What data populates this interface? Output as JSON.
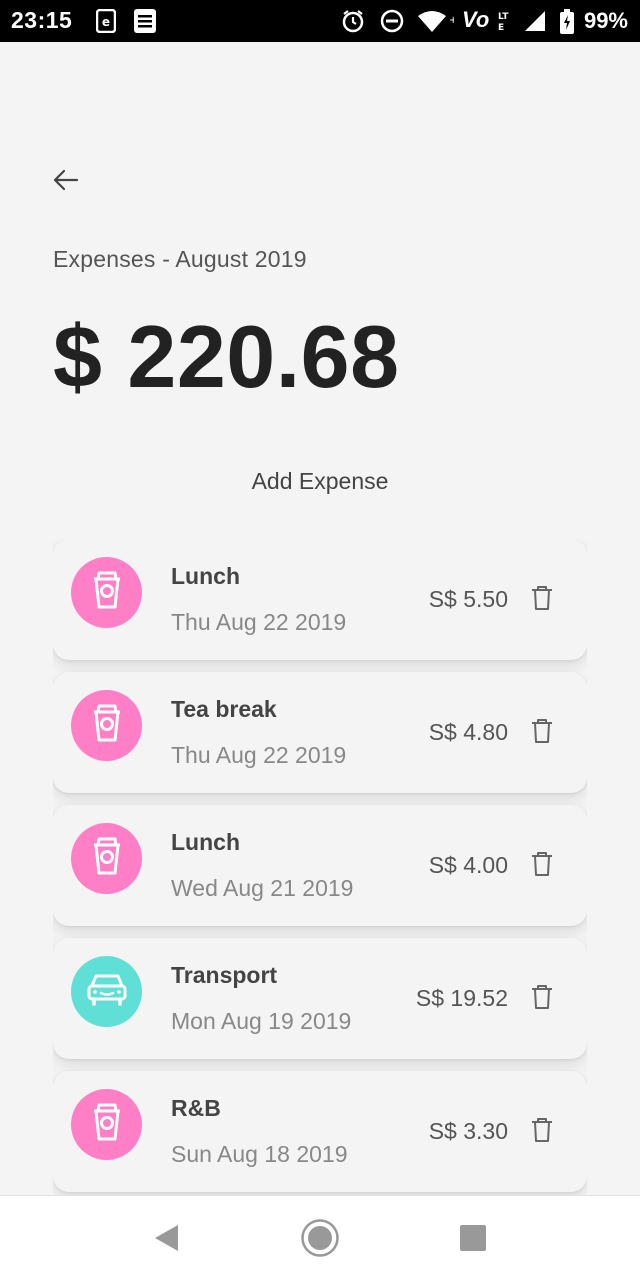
{
  "status_bar": {
    "time": "23:15",
    "volte": "Vo",
    "battery": "99%"
  },
  "header": {
    "subtitle": "Expenses - August 2019",
    "total": "$ 220.68",
    "add_label": "Add Expense"
  },
  "colors": {
    "food": "#ff7fc6",
    "transport": "#5fdfd6"
  },
  "expenses": [
    {
      "name": "Lunch",
      "date": "Thu Aug 22 2019",
      "amount": "S$ 5.50",
      "icon": "cup-icon"
    },
    {
      "name": "Tea break",
      "date": "Thu Aug 22 2019",
      "amount": "S$ 4.80",
      "icon": "cup-icon"
    },
    {
      "name": "Lunch",
      "date": "Wed Aug 21 2019",
      "amount": "S$ 4.00",
      "icon": "cup-icon"
    },
    {
      "name": "Transport",
      "date": "Mon Aug 19 2019",
      "amount": "S$ 19.52",
      "icon": "car-icon"
    },
    {
      "name": "R&B",
      "date": "Sun Aug 18 2019",
      "amount": "S$ 3.30",
      "icon": "cup-icon"
    }
  ]
}
